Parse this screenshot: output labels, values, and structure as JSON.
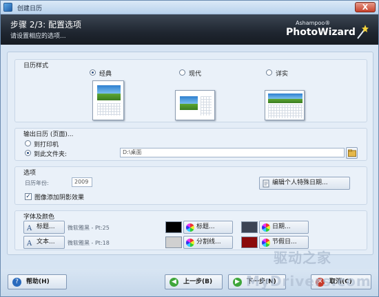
{
  "window": {
    "title": "创建日历",
    "close_label": "X"
  },
  "header": {
    "step": "步骤 2/3: 配置选项",
    "subtitle": "请设置相应的选项...",
    "brand_small": "Ashampoo®",
    "brand_big": "PhotoWizard"
  },
  "calendar_style": {
    "label": "日历样式",
    "options": [
      {
        "label": "经典",
        "selected": true
      },
      {
        "label": "现代",
        "selected": false
      },
      {
        "label": "详实",
        "selected": false
      }
    ]
  },
  "output": {
    "label": "输出日历 (页面)...",
    "options": [
      {
        "label": "到打印机",
        "selected": false
      },
      {
        "label": "到此文件夹:",
        "selected": true
      }
    ],
    "folder_value": "D:\\桌面"
  },
  "options": {
    "label": "选项",
    "year_label": "日历年份:",
    "year_value": "2009",
    "shadow_label": "图像添加阴影效果",
    "shadow_checked": true,
    "edit_dates_button": "编辑个人特殊日期..."
  },
  "fonts_colors": {
    "label": "字体及颜色",
    "title_button": "标题...",
    "title_font": "微软雅黑 - Pt:25",
    "text_button": "文本...",
    "text_font": "微软雅黑 - Pt:18",
    "title_color_button": "标题...",
    "divider_color_button": "分割线...",
    "date_color_button": "日期...",
    "holiday_color_button": "节假日...",
    "title_color": "#000000",
    "divider_color": "#d0d0d0",
    "date_color": "#3c4454",
    "holiday_color": "#8b0a0a"
  },
  "footer": {
    "help_button": "帮助(H)",
    "back_button": "上一步(B)",
    "next_button": "下一步(N)",
    "cancel_button": "取消(C)"
  },
  "watermark": {
    "line1": "驱动之家",
    "line2": "MyDrivers.com"
  },
  "colors": {
    "header_bg": "#1f2630",
    "window_bg": "#d6e4f3",
    "accent": "#2a4e82"
  }
}
